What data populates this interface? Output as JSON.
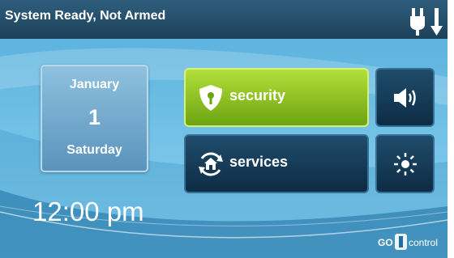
{
  "header": {
    "status_text": "System Ready, Not Armed",
    "power_icon": "power-plug-icon"
  },
  "date": {
    "month": "January",
    "day": "1",
    "weekday": "Saturday"
  },
  "time": "12:00 pm",
  "buttons": {
    "security": {
      "label": "security",
      "icon": "shield-icon"
    },
    "services": {
      "label": "services",
      "icon": "home-refresh-icon"
    },
    "volume": {
      "icon": "volume-icon"
    },
    "brightness": {
      "icon": "brightness-icon"
    }
  },
  "logo": {
    "text_left": "GO",
    "text_right": "control"
  },
  "colors": {
    "header": "#1e4560",
    "background": "#6cc0e4",
    "security_green": "#8cc625",
    "button_dark": "#163a56"
  }
}
